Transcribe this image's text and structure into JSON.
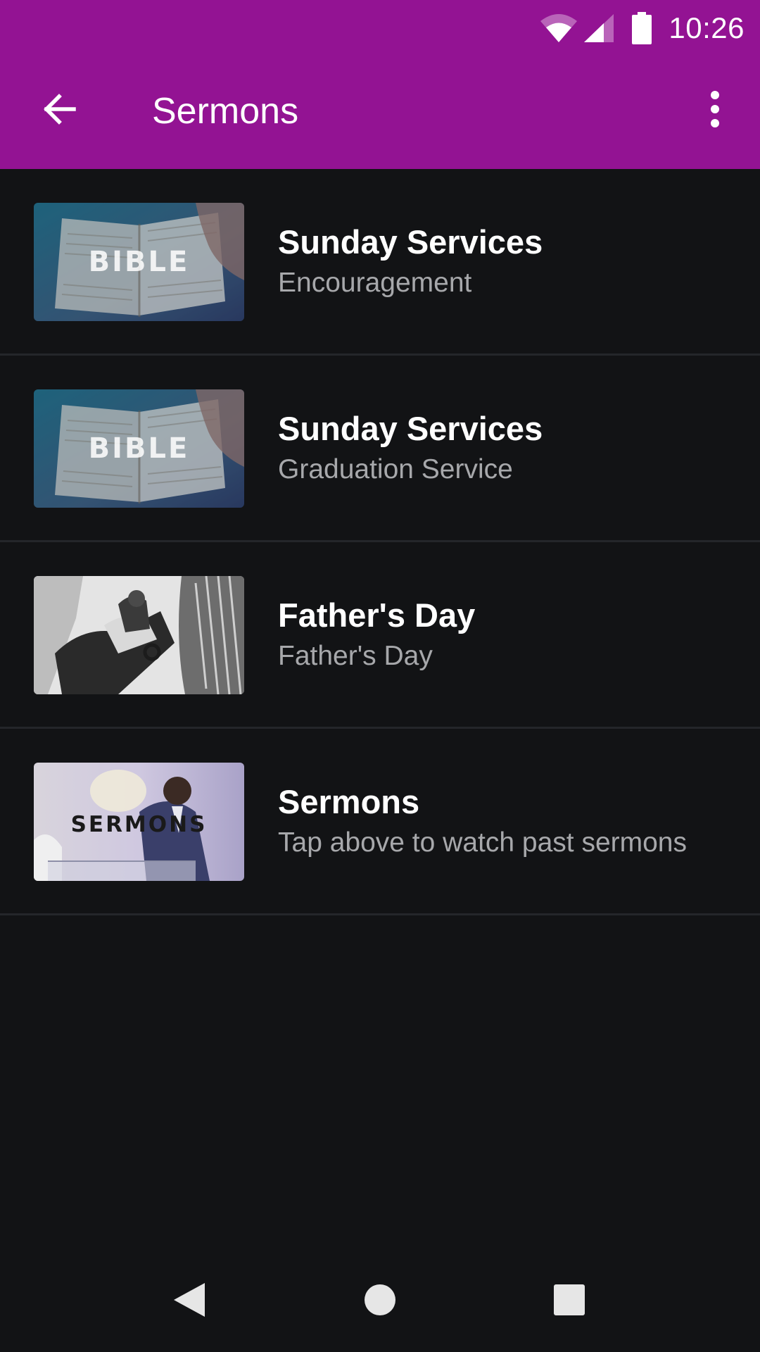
{
  "status_bar": {
    "time": "10:26",
    "icons": [
      "wifi-icon",
      "signal-icon",
      "battery-icon"
    ]
  },
  "app_bar": {
    "title": "Sermons",
    "back_icon": "arrow-back-icon",
    "menu_icon": "more-vert-icon"
  },
  "sermons": {
    "items": [
      {
        "title": "Sunday Services",
        "subtitle": "Encouragement",
        "thumbnail_text": "BIBLE"
      },
      {
        "title": "Sunday Services",
        "subtitle": "Graduation Service",
        "thumbnail_text": "BIBLE"
      },
      {
        "title": "Father's Day",
        "subtitle": "Father's Day",
        "thumbnail_text": ""
      },
      {
        "title": "Sermons",
        "subtitle": "Tap above to watch past sermons",
        "thumbnail_text": "SERMONS"
      }
    ]
  },
  "nav_bar": {
    "icons": [
      "nav-back-icon",
      "nav-home-icon",
      "nav-recents-icon"
    ]
  },
  "colors": {
    "app_bar": "#931393",
    "background": "#121315",
    "divider": "#24262a",
    "title_text": "#ffffff",
    "subtitle_text": "#a7a8ab"
  }
}
